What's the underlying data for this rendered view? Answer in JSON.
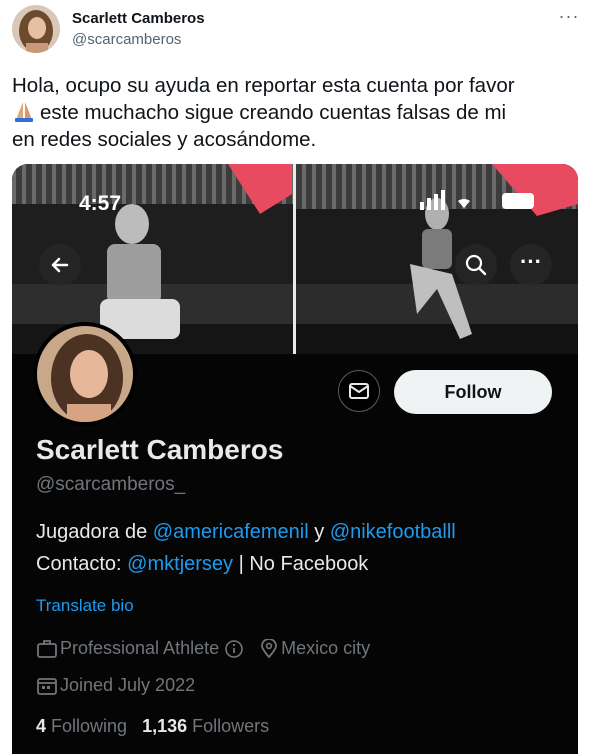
{
  "author": {
    "name": "Scarlett Camberos",
    "handle": "@scarcamberos"
  },
  "more_label": "···",
  "tweet": {
    "line1": "Hola, ocupo su ayuda en reportar esta cuenta por favor",
    "line2": "este muchacho sigue creando cuentas falsas de mi",
    "line3": "en redes sociales y acosándome."
  },
  "screenshot": {
    "status_time": "4:57",
    "back_icon": "←",
    "more_icon": "···",
    "follow_label": "Follow",
    "name": "Scarlett Camberos",
    "handle": "@scarcamberos_",
    "bio_prefix": "Jugadora de ",
    "bio_link1": "@americafemenil",
    "bio_mid": " y ",
    "bio_link2": "@nikefootballl",
    "contact_prefix": "Contacto: ",
    "contact_link": "@mktjersey",
    "contact_suffix": " | No Facebook",
    "translate": "Translate bio",
    "profession": "Professional Athlete",
    "location": "Mexico city",
    "joined": "Joined July 2022",
    "following_count": "4",
    "following_label": "Following",
    "followers_count": "1,136",
    "followers_label": "Followers"
  },
  "colors": {
    "link": "#1d9bf0",
    "heart": "#e84a5f",
    "muted": "#71767b"
  },
  "icons": [
    "pray-emoji",
    "back-arrow-icon",
    "search-icon",
    "more-dots-icon",
    "envelope-icon",
    "briefcase-icon",
    "info-icon",
    "location-pin-icon",
    "calendar-icon",
    "signal-icon",
    "wifi-icon",
    "battery-icon",
    "heart-emoji"
  ]
}
